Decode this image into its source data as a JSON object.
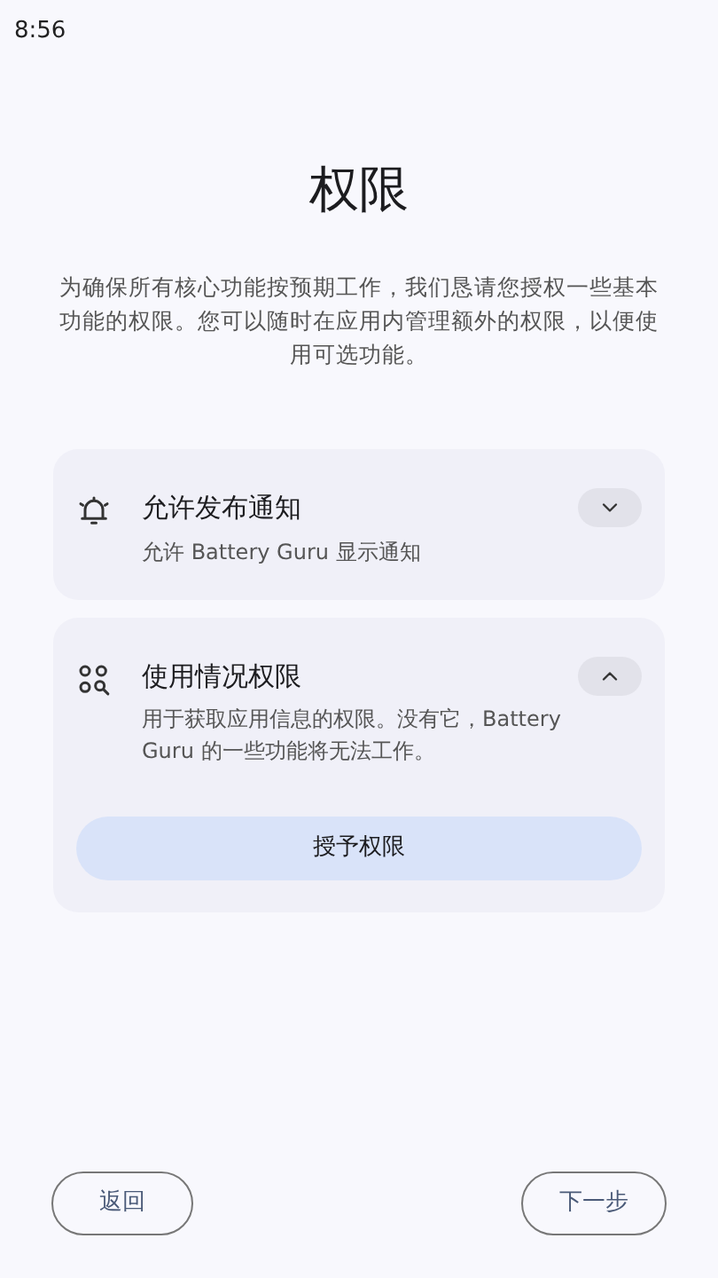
{
  "status_bar": {
    "time": "8:56"
  },
  "title": "权限",
  "description": "为确保所有核心功能按预期工作，我们恳请您授权一些基本功能的权限。您可以随时在应用内管理额外的权限，以便使用可选功能。",
  "permissions": [
    {
      "kind": "notification",
      "title": "允许发布通知",
      "description": "允许 Battery Guru 显示通知",
      "expanded": false
    },
    {
      "kind": "usage",
      "title": "使用情况权限",
      "description": "用于获取应用信息的权限。没有它，Battery Guru 的一些功能将无法工作。",
      "expanded": true,
      "action": "授予权限"
    }
  ],
  "buttons": {
    "back": "返回",
    "next": "下一步"
  }
}
